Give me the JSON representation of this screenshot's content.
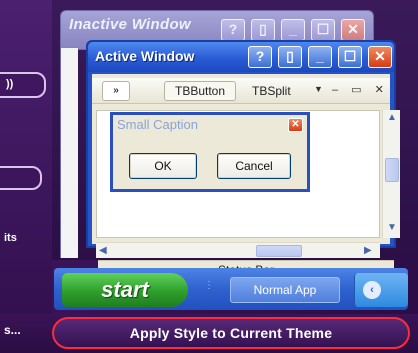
{
  "inactive_window": {
    "title": "Inactive Window",
    "buttons": [
      "?",
      "▯",
      "_",
      "☐",
      "✕"
    ]
  },
  "active_window": {
    "title": "Active Window",
    "buttons": [
      "?",
      "▯",
      "_",
      "☐",
      "✕"
    ],
    "toolbar": {
      "chevron": "»",
      "tbbutton": "TBButton",
      "tbsplit": "TBSplit",
      "split_arrow": "▼",
      "mdi_controls": "– ▭ ✕"
    },
    "status_bar": "Status Bar",
    "scroll": {
      "up": "▲",
      "down": "▼",
      "left": "◀",
      "right": "▶"
    }
  },
  "small_dialog": {
    "title": "Small Caption",
    "close": "✕",
    "ok": "OK",
    "cancel": "Cancel"
  },
  "taskbar": {
    "start": "start",
    "quick_launch": "⋮",
    "app": "Normal App",
    "tray_icon": "‹"
  },
  "sidebar": {
    "pill_1": "))",
    "text_1": "its",
    "bottom_left": "s..."
  },
  "apply_button": "Apply Style to Current Theme"
}
